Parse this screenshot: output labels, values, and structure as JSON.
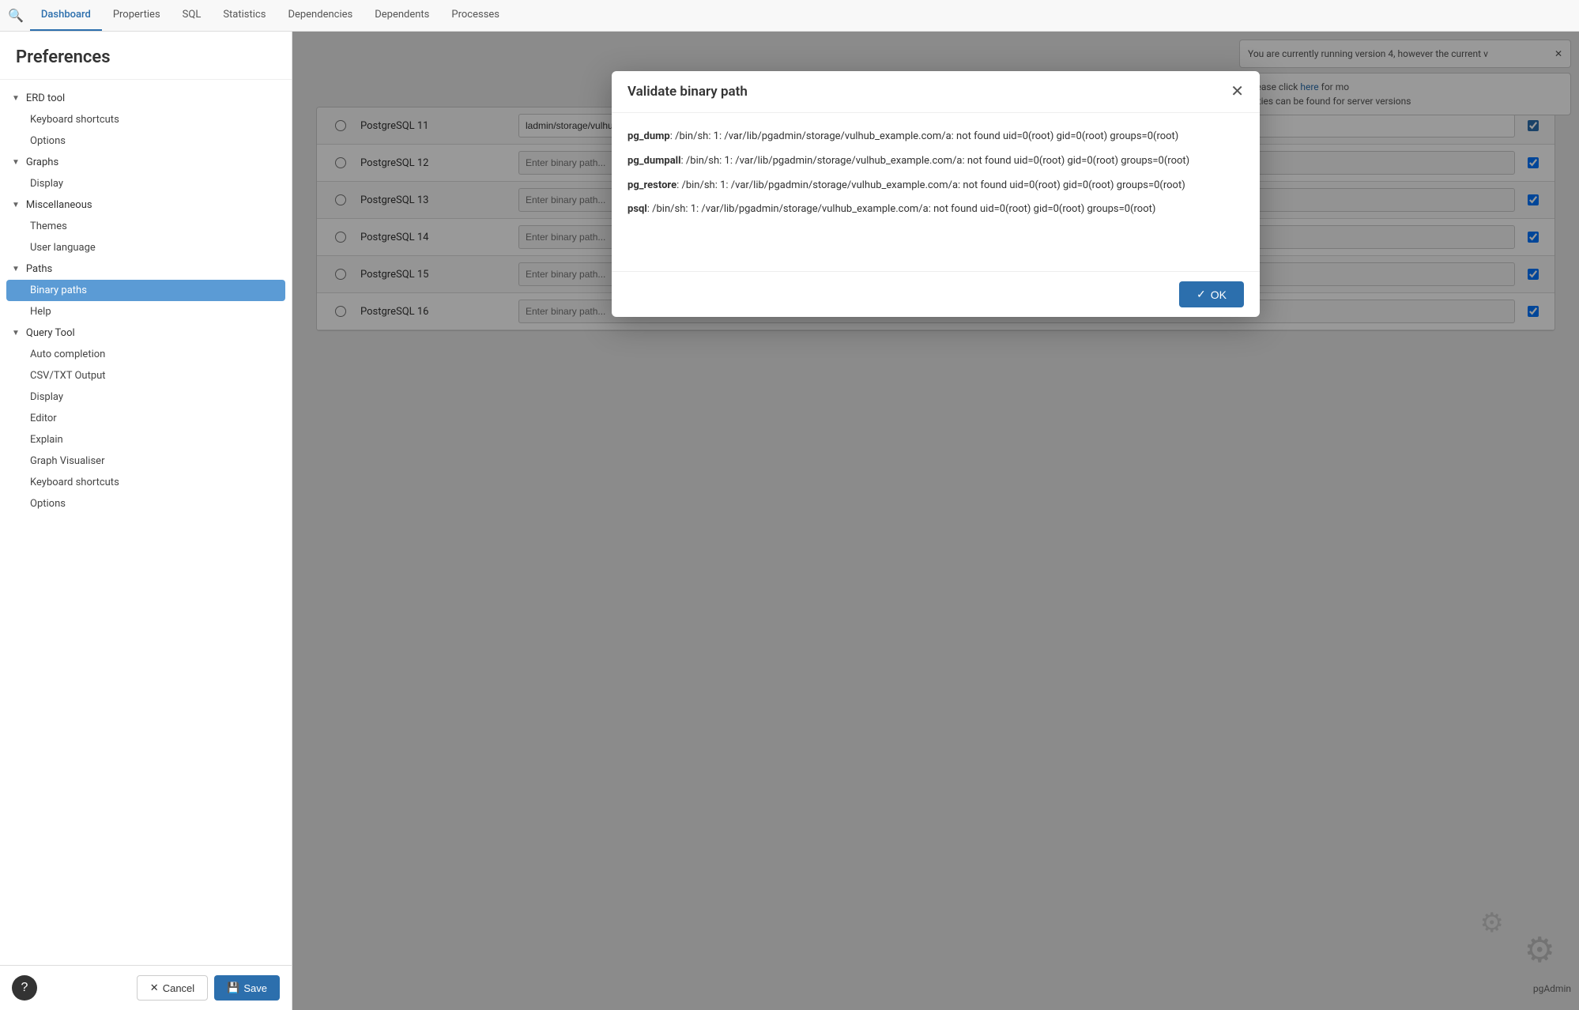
{
  "tabs": {
    "items": [
      {
        "label": "Dashboard",
        "active": true
      },
      {
        "label": "Properties"
      },
      {
        "label": "SQL"
      },
      {
        "label": "Statistics"
      },
      {
        "label": "Dependencies"
      },
      {
        "label": "Dependents"
      },
      {
        "label": "Processes"
      }
    ]
  },
  "preferences": {
    "title": "Preferences",
    "sections": [
      {
        "label": "ERD tool",
        "expanded": true,
        "children": [
          {
            "label": "Keyboard shortcuts"
          },
          {
            "label": "Options"
          }
        ]
      },
      {
        "label": "Graphs",
        "expanded": true,
        "children": [
          {
            "label": "Display"
          }
        ]
      },
      {
        "label": "Miscellaneous",
        "expanded": true,
        "children": [
          {
            "label": "Themes"
          },
          {
            "label": "User language"
          }
        ]
      },
      {
        "label": "Paths",
        "expanded": true,
        "children": [
          {
            "label": "Binary paths",
            "active": true
          },
          {
            "label": "Help"
          }
        ]
      },
      {
        "label": "Query Tool",
        "expanded": true,
        "children": [
          {
            "label": "Auto completion"
          },
          {
            "label": "CSV/TXT Output"
          },
          {
            "label": "Display"
          },
          {
            "label": "Editor"
          },
          {
            "label": "Explain"
          },
          {
            "label": "Graph Visualiser"
          },
          {
            "label": "Keyboard shortcuts"
          },
          {
            "label": "Options"
          }
        ]
      }
    ],
    "footer": {
      "cancel_label": "Cancel",
      "save_label": "Save"
    }
  },
  "binary_table": {
    "rows": [
      {
        "version": "PostgreSQL 11",
        "path": "ladmin/storage/vulhub_example.com/a\";id;#",
        "checked": true
      },
      {
        "version": "PostgreSQL 12",
        "path": "",
        "placeholder": "Enter binary path...",
        "checked": true
      },
      {
        "version": "PostgreSQL 13",
        "path": "",
        "placeholder": "Enter binary path...",
        "checked": true
      },
      {
        "version": "PostgreSQL 14",
        "path": "",
        "placeholder": "Enter binary path...",
        "checked": true
      },
      {
        "version": "PostgreSQL 15",
        "path": "",
        "placeholder": "Enter binary path...",
        "checked": true
      },
      {
        "version": "PostgreSQL 16",
        "path": "",
        "placeholder": "Enter binary path...",
        "checked": true
      }
    ]
  },
  "modal": {
    "title": "Validate binary path",
    "lines": [
      {
        "label": "pg_dump",
        "text": ": /bin/sh: 1: /var/lib/pgadmin/storage/vulhub_example.com/a: not found uid=0(root) gid=0(root) groups=0(root)"
      },
      {
        "label": "pg_dumpall",
        "text": ": /bin/sh: 1: /var/lib/pgadmin/storage/vulhub_example.com/a: not found uid=0(root) gid=0(root) groups=0(root)"
      },
      {
        "label": "pg_restore",
        "text": ": /bin/sh: 1: /var/lib/pgadmin/storage/vulhub_example.com/a: not found uid=0(root) gid=0(root) groups=0(root)"
      },
      {
        "label": "psql",
        "text": ": /bin/sh: 1: /var/lib/pgadmin/storage/vulhub_example.com/a: not found uid=0(root) gid=0(root) groups=0(root)"
      }
    ],
    "ok_label": "OK"
  },
  "right_panel": {
    "info_text": "You are currently running version 4, however the current v",
    "utilities_text": "tilities can be found for server versions",
    "pgadmin_label": "pgAdmin"
  }
}
